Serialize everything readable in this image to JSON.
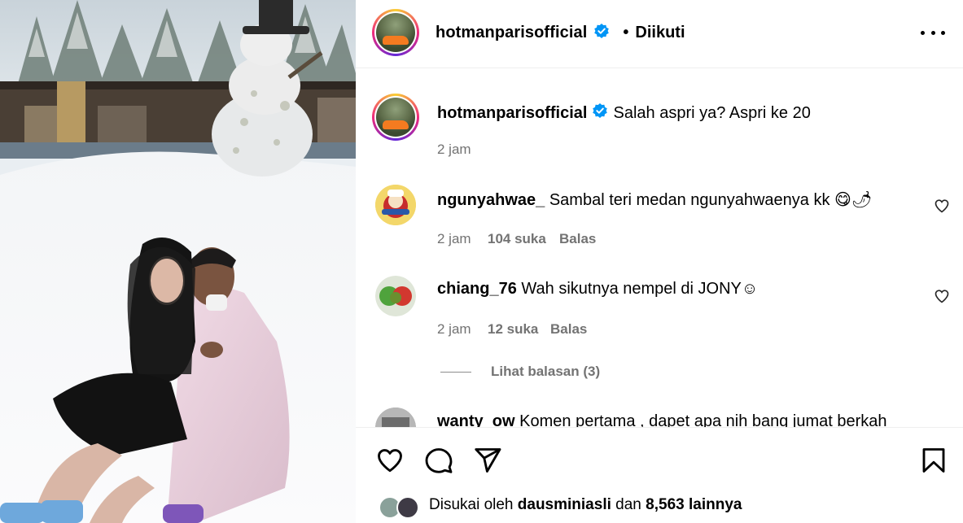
{
  "post": {
    "username": "hotmanparisofficial",
    "follow_dot": "•",
    "follow_status": "Diikuti",
    "photo_alt": "photo-snow-couple"
  },
  "caption": {
    "username": "hotmanparisofficial",
    "text": "Salah aspri ya? Aspri ke 20",
    "time": "2 jam"
  },
  "comments": [
    {
      "username": "ngunyahwae_",
      "text": "Sambal teri medan ngunyahwaenya kk 😋🌶",
      "time": "2 jam",
      "likes": "104 suka",
      "reply": "Balas"
    },
    {
      "username": "chiang_76",
      "text": "Wah sikutnya nempel di JONY☺",
      "time": "2 jam",
      "likes": "12 suka",
      "reply": "Balas",
      "view_replies": "Lihat balasan (3)"
    },
    {
      "username": "wanty_ow",
      "text": "Komen pertama , dapet apa nih bang jumat berkah"
    }
  ],
  "likes_bar": {
    "prefix": "Disukai oleh",
    "user": "dausminiasli",
    "joiner": "dan",
    "count": "8,563 lainnya"
  },
  "colors": {
    "verified": "#0095f6",
    "secondary_text": "#737373",
    "divider": "#efefef"
  },
  "icons": [
    "more-options-icon",
    "verified-badge-icon",
    "heart-icon",
    "comment-icon",
    "share-icon",
    "bookmark-icon"
  ]
}
